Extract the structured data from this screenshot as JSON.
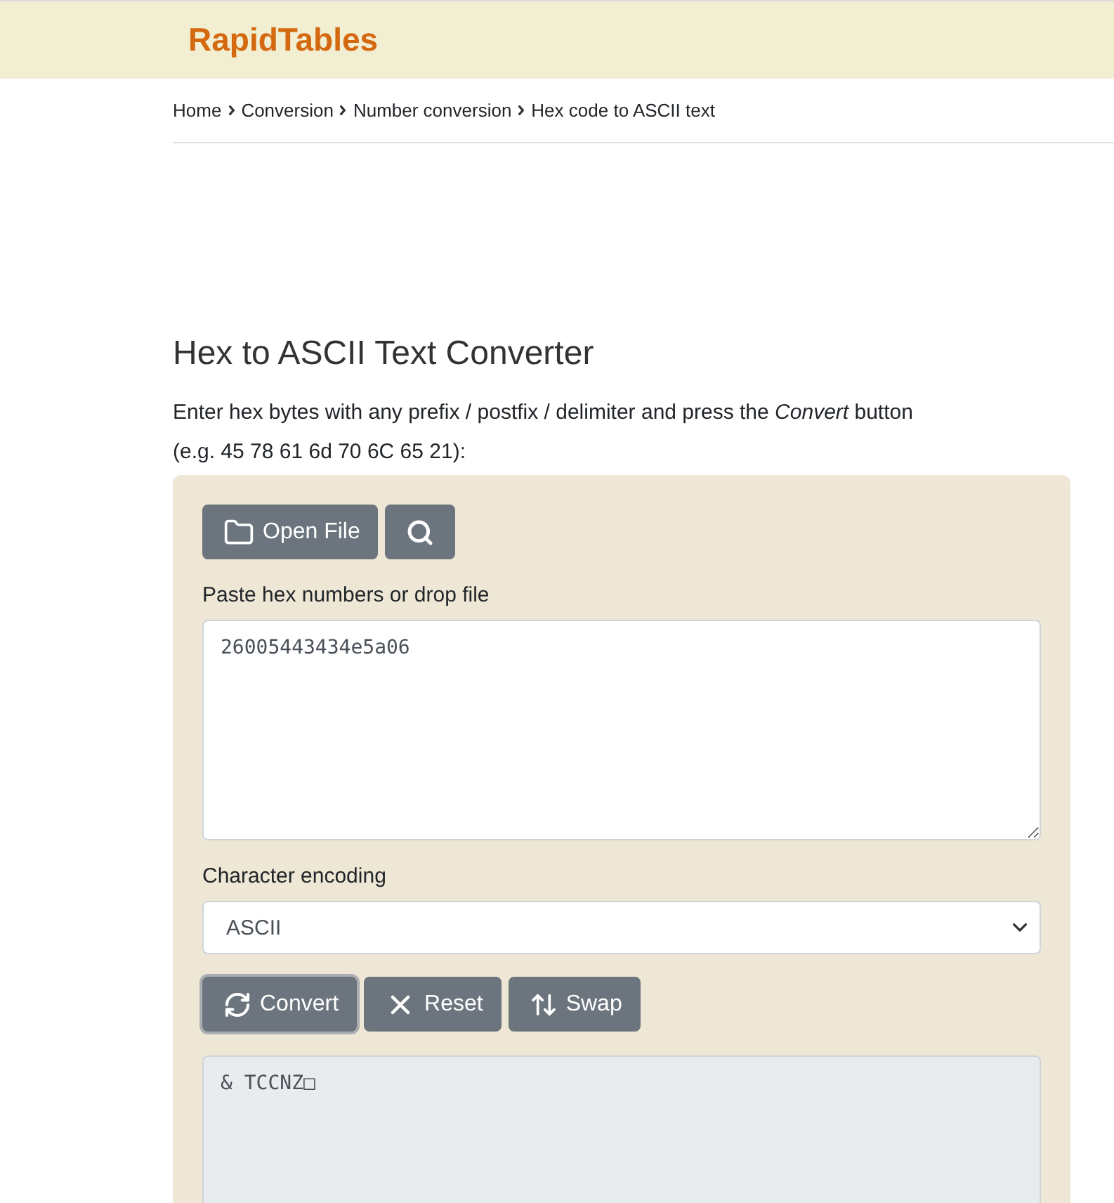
{
  "header": {
    "logo": "RapidTables"
  },
  "breadcrumb": [
    {
      "label": "Home"
    },
    {
      "label": "Conversion"
    },
    {
      "label": "Number conversion"
    },
    {
      "label": "Hex code to ASCII text"
    }
  ],
  "title": "Hex to ASCII Text Converter",
  "intro": [
    "Enter hex bytes with any prefix / postfix / delimiter and press the *Convert* button",
    "(e.g. 45 78 61 6d 70 6C 65 21):"
  ],
  "converter": {
    "toolbar": [
      {
        "kind": "open_file",
        "label": "Open File"
      },
      {
        "kind": "search"
      }
    ],
    "input": {
      "label": "Paste hex numbers or drop file",
      "value": "26005443434e5a06"
    },
    "encoding": {
      "label": "Character encoding",
      "value": "ASCII"
    },
    "actions": [
      {
        "kind": "convert",
        "label": "Convert",
        "focused": true
      },
      {
        "kind": "reset",
        "label": "Reset",
        "focused": false
      },
      {
        "kind": "swap",
        "label": "Swap",
        "focused": false
      }
    ],
    "output": {
      "value": "& TCCNZ□"
    }
  }
}
